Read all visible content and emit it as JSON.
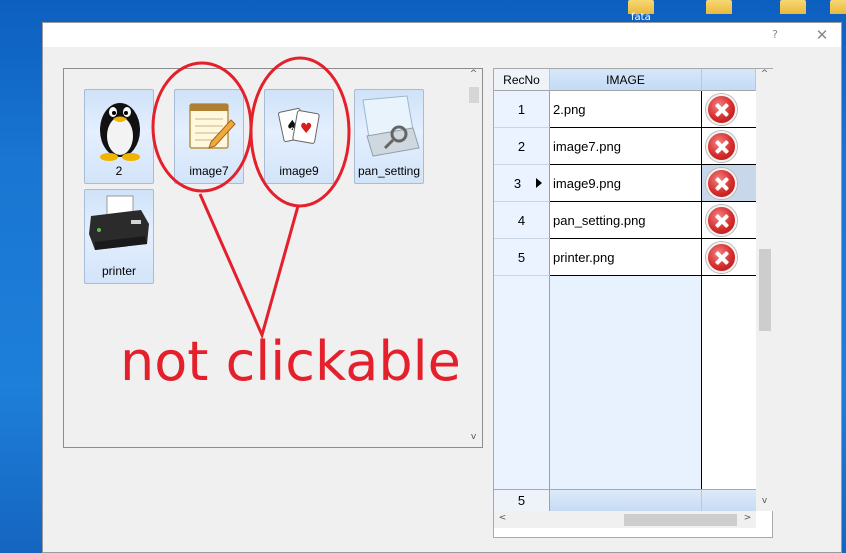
{
  "desktop": {
    "icon_labels": [
      "fata"
    ]
  },
  "window": {
    "help_glyph": "?",
    "close_glyph": "✕"
  },
  "left_panel": {
    "tiles": [
      {
        "label": "2",
        "icon": "penguin-icon"
      },
      {
        "label": "image7",
        "icon": "notepad-icon"
      },
      {
        "label": "image9",
        "icon": "playing-cards-icon"
      },
      {
        "label": "pan_setting",
        "icon": "scanner-icon"
      },
      {
        "label": "printer",
        "icon": "printer-icon"
      }
    ],
    "scroll_up": "^",
    "scroll_down": "v"
  },
  "annotation": {
    "text": "not clickable",
    "color": "#e3202b"
  },
  "grid": {
    "headers": {
      "recno": "RecNo",
      "image": "IMAGE",
      "action": ""
    },
    "rows": [
      {
        "recno": "1",
        "image": "2.png"
      },
      {
        "recno": "2",
        "image": "image7.png"
      },
      {
        "recno": "3",
        "image": "image9.png",
        "current": true
      },
      {
        "recno": "4",
        "image": "pan_setting.png"
      },
      {
        "recno": "5",
        "image": "printer.png"
      }
    ],
    "footer_recno": "5",
    "scroll_up": "^",
    "scroll_down": "v",
    "scroll_left": "<",
    "scroll_right": ">",
    "delete_icon": "delete-icon",
    "accent": "#c3dbf6"
  }
}
